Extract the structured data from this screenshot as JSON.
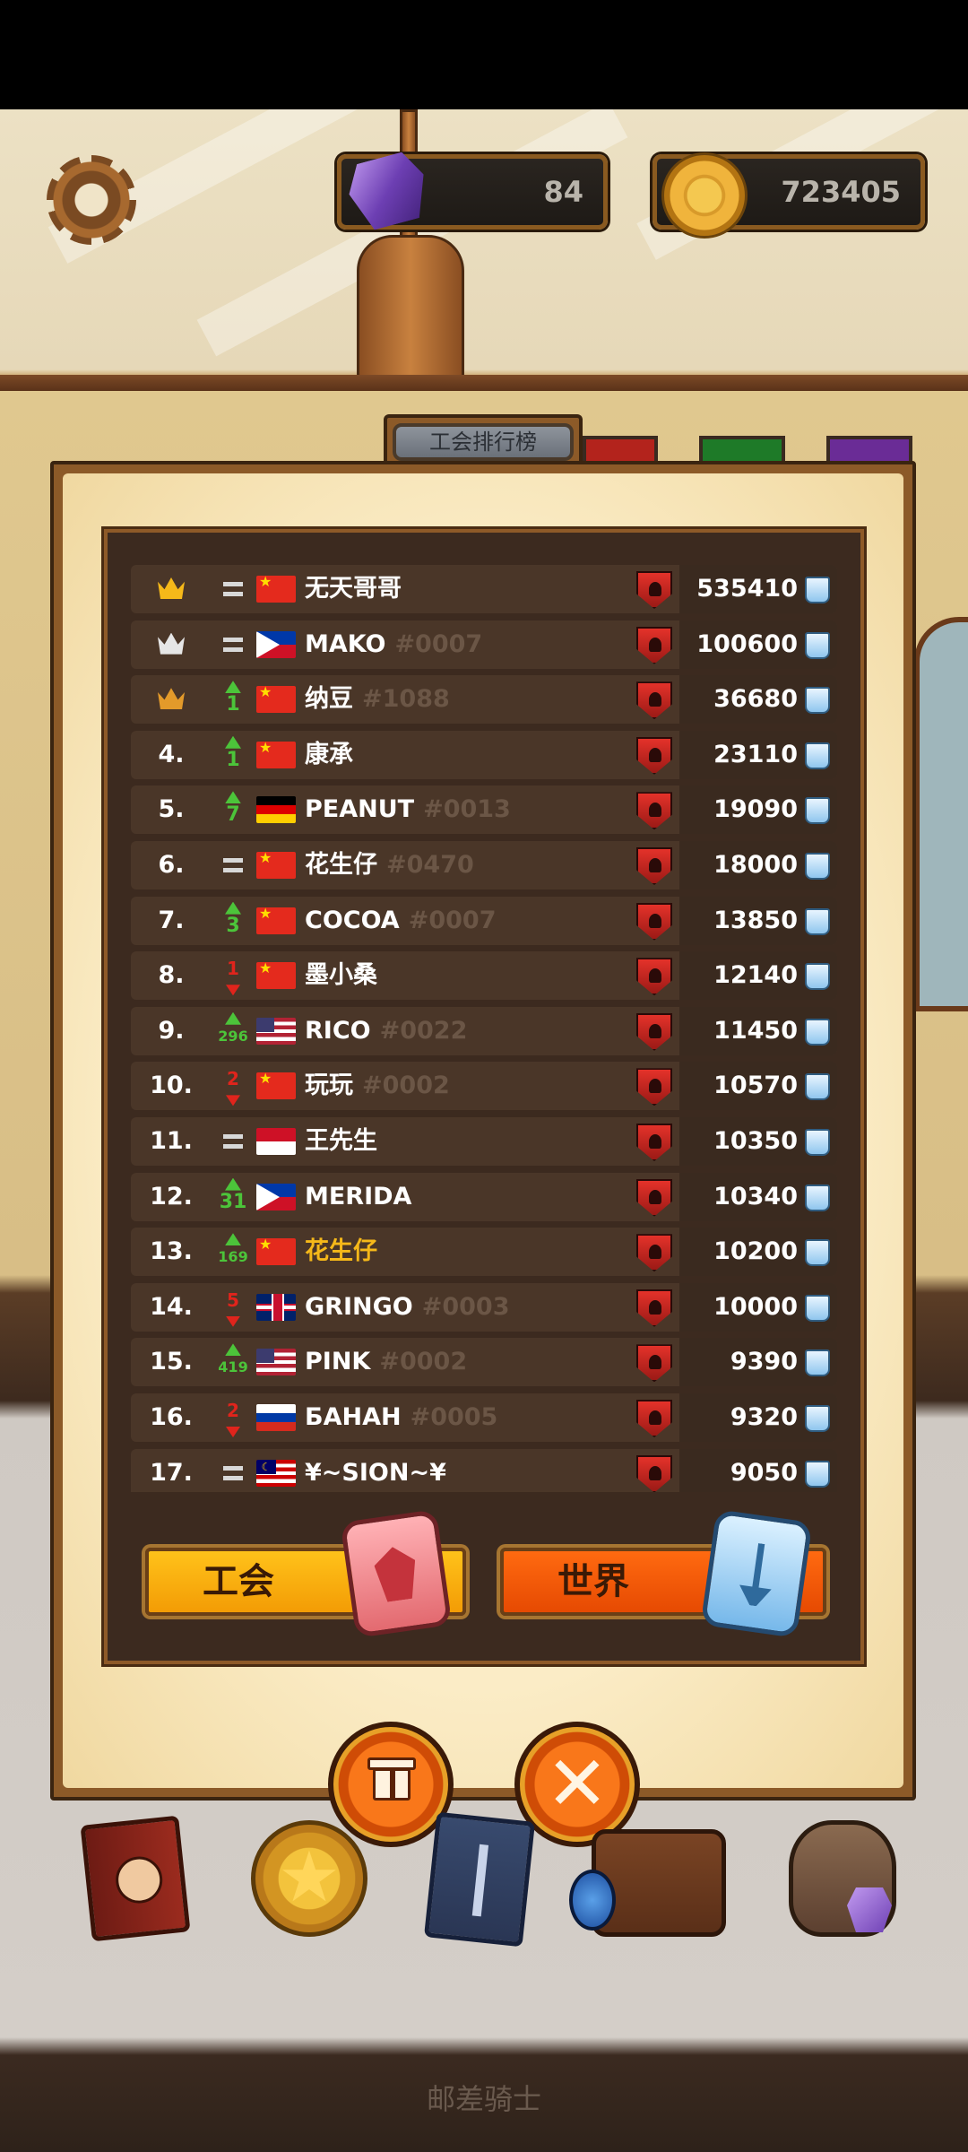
{
  "hud": {
    "gems": "84",
    "gold": "723405"
  },
  "panel": {
    "title": "工会排行榜",
    "tabs": {
      "guild": "工会",
      "world": "世界"
    }
  },
  "rows": [
    {
      "rank": "",
      "crown": "gold",
      "change": "same",
      "change_value": "",
      "flag": "cn",
      "name": "无天哥哥",
      "tag": "",
      "highlight": false,
      "score": "535410"
    },
    {
      "rank": "",
      "crown": "silver",
      "change": "same",
      "change_value": "",
      "flag": "ph",
      "name": "MAKO",
      "tag": "#0007",
      "highlight": false,
      "score": "100600"
    },
    {
      "rank": "",
      "crown": "bronze",
      "change": "up",
      "change_value": "1",
      "flag": "cn",
      "name": "纳豆",
      "tag": "#1088",
      "highlight": false,
      "score": "36680"
    },
    {
      "rank": "4.",
      "crown": "",
      "change": "up",
      "change_value": "1",
      "flag": "cn",
      "name": "康承",
      "tag": "",
      "highlight": false,
      "score": "23110"
    },
    {
      "rank": "5.",
      "crown": "",
      "change": "up",
      "change_value": "7",
      "flag": "de",
      "name": "PEANUT",
      "tag": "#0013",
      "highlight": false,
      "score": "19090"
    },
    {
      "rank": "6.",
      "crown": "",
      "change": "same",
      "change_value": "",
      "flag": "cn",
      "name": "花生仔",
      "tag": "#0470",
      "highlight": false,
      "score": "18000"
    },
    {
      "rank": "7.",
      "crown": "",
      "change": "up",
      "change_value": "3",
      "flag": "cn",
      "name": "COCOA",
      "tag": "#0007",
      "highlight": false,
      "score": "13850"
    },
    {
      "rank": "8.",
      "crown": "",
      "change": "down",
      "change_value": "1",
      "flag": "cn",
      "name": "墨小桑",
      "tag": "",
      "highlight": false,
      "score": "12140"
    },
    {
      "rank": "9.",
      "crown": "",
      "change": "up",
      "change_value": "296",
      "flag": "us",
      "name": "RICO",
      "tag": "#0022",
      "highlight": false,
      "score": "11450"
    },
    {
      "rank": "10.",
      "crown": "",
      "change": "down",
      "change_value": "2",
      "flag": "cn",
      "name": "玩玩",
      "tag": "#0002",
      "highlight": false,
      "score": "10570"
    },
    {
      "rank": "11.",
      "crown": "",
      "change": "same",
      "change_value": "",
      "flag": "id",
      "name": "王先生",
      "tag": "",
      "highlight": false,
      "score": "10350"
    },
    {
      "rank": "12.",
      "crown": "",
      "change": "up",
      "change_value": "31",
      "flag": "ph",
      "name": "MERIDA",
      "tag": "",
      "highlight": false,
      "score": "10340"
    },
    {
      "rank": "13.",
      "crown": "",
      "change": "up",
      "change_value": "169",
      "flag": "cn",
      "name": "花生仔",
      "tag": "",
      "highlight": true,
      "score": "10200"
    },
    {
      "rank": "14.",
      "crown": "",
      "change": "down",
      "change_value": "5",
      "flag": "gb",
      "name": "GRINGO",
      "tag": "#0003",
      "highlight": false,
      "score": "10000"
    },
    {
      "rank": "15.",
      "crown": "",
      "change": "up",
      "change_value": "419",
      "flag": "us",
      "name": "PINK",
      "tag": "#0002",
      "highlight": false,
      "score": "9390"
    },
    {
      "rank": "16.",
      "crown": "",
      "change": "down",
      "change_value": "2",
      "flag": "ru",
      "name": "БАНАН",
      "tag": "#0005",
      "highlight": false,
      "score": "9320"
    },
    {
      "rank": "17.",
      "crown": "",
      "change": "same",
      "change_value": "",
      "flag": "my",
      "name": "¥~SION~¥",
      "tag": "",
      "highlight": false,
      "score": "9050"
    }
  ],
  "footer": "邮差骑士",
  "icons": {
    "settings": "gear-icon",
    "gem": "gem-icon",
    "gold": "coin-icon",
    "gift": "gift-icon",
    "close": "close-icon"
  },
  "colors": {
    "crown_gold": "#f5b819",
    "crown_silver": "#e6e6e6",
    "crown_bronze": "#e39a2a",
    "up": "#4cc43a",
    "down": "#e0241c",
    "highlight_name": "#f5b819"
  }
}
